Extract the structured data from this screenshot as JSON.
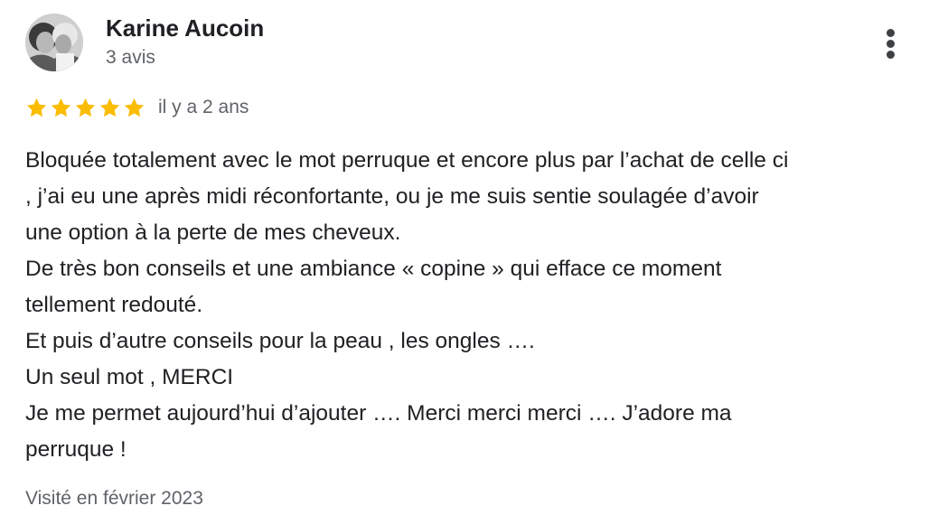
{
  "author": {
    "name": "Karine Aucoin",
    "review_count": "3 avis",
    "avatar_icon": "profile-photo-icon"
  },
  "menu": {
    "icon": "more-vert-icon"
  },
  "rating": {
    "stars": 5,
    "max_stars": 5,
    "star_color": "#fbbc04",
    "date": "il y a 2 ans"
  },
  "review": {
    "lines": [
      "Bloquée totalement avec le mot perruque et encore plus par l’achat de celle ci",
      ", j’ai eu une après midi réconfortante, ou je me suis sentie soulagée d’avoir",
      "une option à la perte de mes cheveux.",
      "De très bon conseils et une ambiance « copine » qui efface ce moment",
      "tellement redouté.",
      "Et puis d’autre conseils pour la peau , les ongles ….",
      "Un seul mot , MERCI",
      "Je me permet aujourd’hui d’ajouter …. Merci merci merci …. J’adore ma",
      "perruque !"
    ]
  },
  "visited": "Visité en février 2023"
}
